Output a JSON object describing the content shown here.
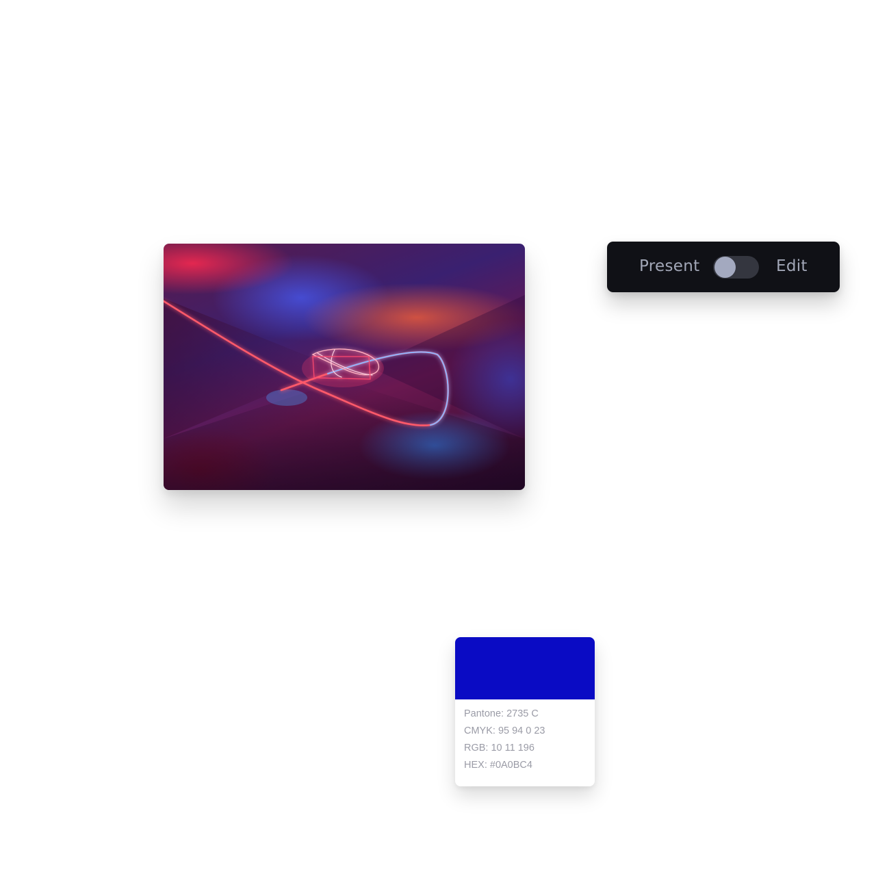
{
  "image_card": {
    "description_icon": "neon-light-loop-image"
  },
  "mode_toggle": {
    "present_label": "Present",
    "edit_label": "Edit",
    "state": "present",
    "bar_color": "#101116",
    "track_color": "#34363f",
    "knob_color": "#a3a9bf"
  },
  "swatch": {
    "color": "#0A0BC4",
    "pantone_label": "Pantone:",
    "pantone_value": "2735 C",
    "cmyk_label": "CMYK:",
    "cmyk_value": "95 94 0 23",
    "rgb_label": "RGB:",
    "rgb_value": "10 11 196",
    "hex_label": "HEX:",
    "hex_value": "#0A0BC4"
  }
}
